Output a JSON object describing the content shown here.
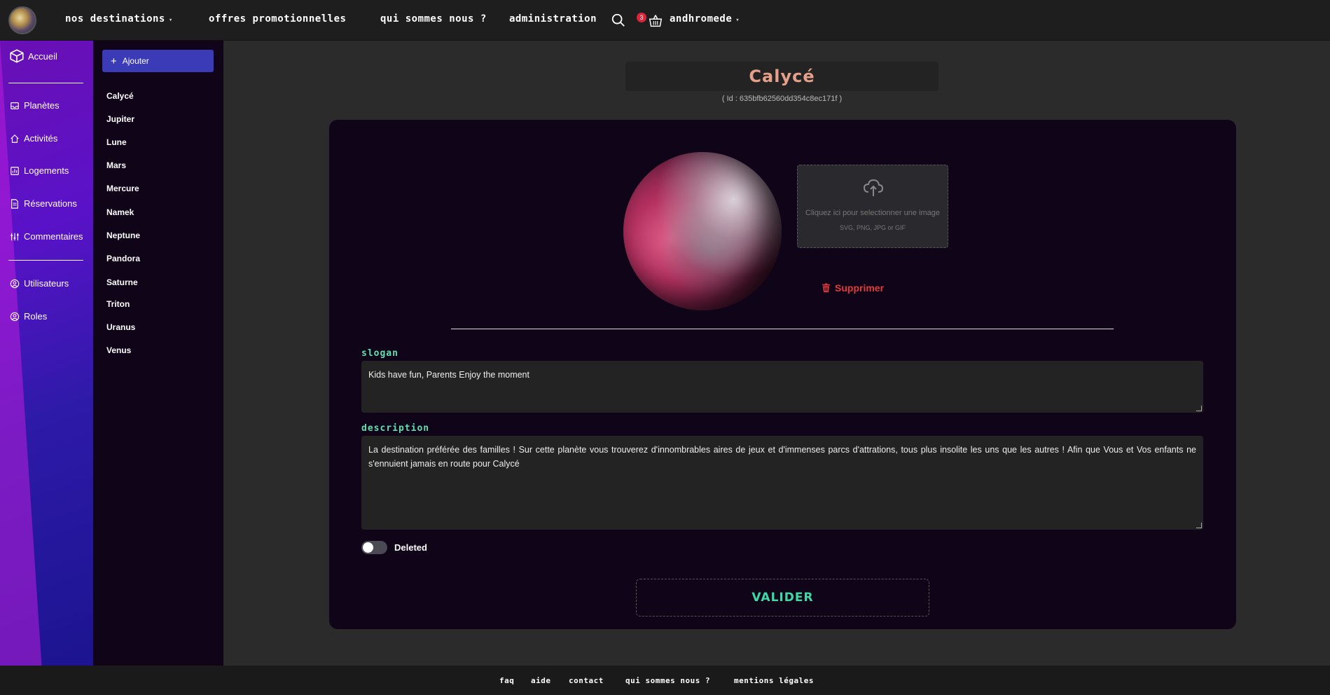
{
  "header": {
    "nav": [
      {
        "label": "Nos destinations",
        "dropdown": true
      },
      {
        "label": "Offres promotionnelles",
        "dropdown": false
      },
      {
        "label": "Qui sommes nous ?",
        "dropdown": false
      },
      {
        "label": "Administration",
        "dropdown": false
      }
    ],
    "cart_count": "3",
    "user_label": "Andhromede",
    "icons": [
      "search-icon",
      "basket-icon",
      "chevron-down-icon"
    ]
  },
  "sidebar": {
    "items": [
      {
        "label": "Accueil",
        "icon": "cube-icon"
      },
      {
        "label": "Planètes",
        "icon": "inbox-icon"
      },
      {
        "label": "Activités",
        "icon": "home-icon"
      },
      {
        "label": "Logements",
        "icon": "chart-icon"
      },
      {
        "label": "Réservations",
        "icon": "document-icon"
      },
      {
        "label": "Commentaires",
        "icon": "sliders-icon"
      },
      {
        "label": "Utilisateurs",
        "icon": "user-circle-icon"
      },
      {
        "label": "Roles",
        "icon": "user-circle-icon"
      }
    ]
  },
  "planet_list": {
    "add_label": "Ajouter",
    "items": [
      "Calycé",
      "Jupiter",
      "Lune",
      "Mars",
      "Mercure",
      "Namek",
      "Neptune",
      "Pandora",
      "Saturne",
      "Triton",
      "Uranus",
      "Venus"
    ]
  },
  "detail": {
    "title": "Calycé",
    "id_text": "( Id : 635bfb62560dd354c8ec171f )",
    "upload_main": "Cliquez ici pour selectionner une image",
    "upload_sub": "SVG, PNG, JPG or GIF",
    "delete_label": "Supprimer",
    "slogan_label": "Slogan",
    "slogan_value": "Kids have fun, Parents Enjoy the moment",
    "description_label": "Description",
    "description_value": "La destination préférée des familles ! Sur cette planète vous trouverez d'innombrables aires de jeux et d'immenses parcs d'attrations, tous plus insolite les uns que les autres ! Afin que Vous et Vos enfants ne s'ennuient jamais en route pour Calycé",
    "deleted_label": "Deleted",
    "deleted_value": false,
    "submit_label": "VALIDER"
  },
  "footer": {
    "links": [
      "FAQ",
      "Aide",
      "Contact",
      "Qui sommes nous ?",
      "Mentions légales"
    ]
  },
  "colors": {
    "title": "#e6a08a",
    "field_label": "#5fe0b0",
    "submit": "#3fd9a5",
    "delete": "#e23b3b",
    "add_button": "#3b3bb8",
    "badge": "#d8263b"
  }
}
